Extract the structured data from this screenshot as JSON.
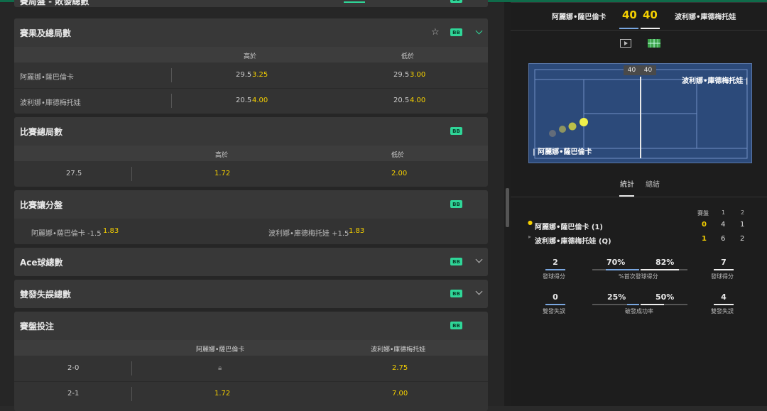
{
  "top_partial": {
    "title": "賽局盤 - 敗發總數"
  },
  "markets": {
    "set_total": {
      "title": "賽果及總局數",
      "bb": "BB",
      "col_over": "高於",
      "col_under": "低於",
      "rows": [
        {
          "name": "阿麗娜•薩巴倫卡",
          "over_line": "29.5",
          "over_odds": "3.25",
          "under_line": "29.5",
          "under_odds": "3.00"
        },
        {
          "name": "波利娜•庫德梅托娃",
          "over_line": "20.5",
          "over_odds": "4.00",
          "under_line": "20.5",
          "under_odds": "4.00"
        }
      ]
    },
    "match_games": {
      "title": "比賽總局數",
      "bb": "BB",
      "col_over": "高於",
      "col_under": "低於",
      "line": "27.5",
      "over_odds": "1.72",
      "under_odds": "2.00"
    },
    "handicap": {
      "title": "比賽讓分盤",
      "bb": "BB",
      "p1_label": "阿麗娜•薩巴倫卡 -1.5",
      "p1_odds": "1.83",
      "p2_label": "波利娜•庫德梅托娃 +1.5",
      "p2_odds": "1.83"
    },
    "aces": {
      "title": "Ace球總數",
      "bb": "BB"
    },
    "double_faults": {
      "title": "雙發失誤總數",
      "bb": "BB"
    },
    "set_betting": {
      "title": "賽盤投注",
      "bb": "BB",
      "col_p1": "阿麗娜•薩巴倫卡",
      "col_p2": "波利娜•庫德梅托娃",
      "rows": [
        {
          "score": "2-0",
          "p1_odds": "",
          "p2_odds": "2.75",
          "p1_locked": true
        },
        {
          "score": "2-1",
          "p1_odds": "1.72",
          "p2_odds": "7.00",
          "p1_locked": false
        }
      ]
    }
  },
  "scoreboard": {
    "p1": "阿麗娜•薩巴倫卡",
    "p2": "波利娜•庫德梅托娃",
    "p1_points": "40",
    "p2_points": "40",
    "court_p1": "| 阿麗娜•薩巴倫卡",
    "court_p2": "波利娜•庫德梅托娃 |",
    "court_score_p1": "40",
    "court_score_p2": "40",
    "tab_stats": "統計",
    "tab_summary": "總結",
    "sets_header": "賽盤",
    "set_cols": [
      "1",
      "2"
    ],
    "row1_name": "阿麗娜•薩巴倫卡 (1)",
    "row1_game": "0",
    "row1_sets": [
      "4",
      "1"
    ],
    "row2_name": "波利娜•庫德梅托娃 (Q)",
    "row2_game": "1",
    "row2_sets": [
      "6",
      "2"
    ],
    "colors": {
      "accent": "#f5d000",
      "bb": "#2fd698",
      "court": "#2c4a7a"
    }
  },
  "stats": {
    "aces_p1": "2",
    "aces_label": "發球得分",
    "aces_p2": "7",
    "first_serve_p1": "70%",
    "first_serve_label": "%首次發球得分",
    "first_serve_p2": "82%",
    "df_p1": "0",
    "df_label": "雙發失誤",
    "df_p2": "4",
    "bp_p1": "25%",
    "bp_label": "破發成功率",
    "bp_p2": "50%"
  }
}
